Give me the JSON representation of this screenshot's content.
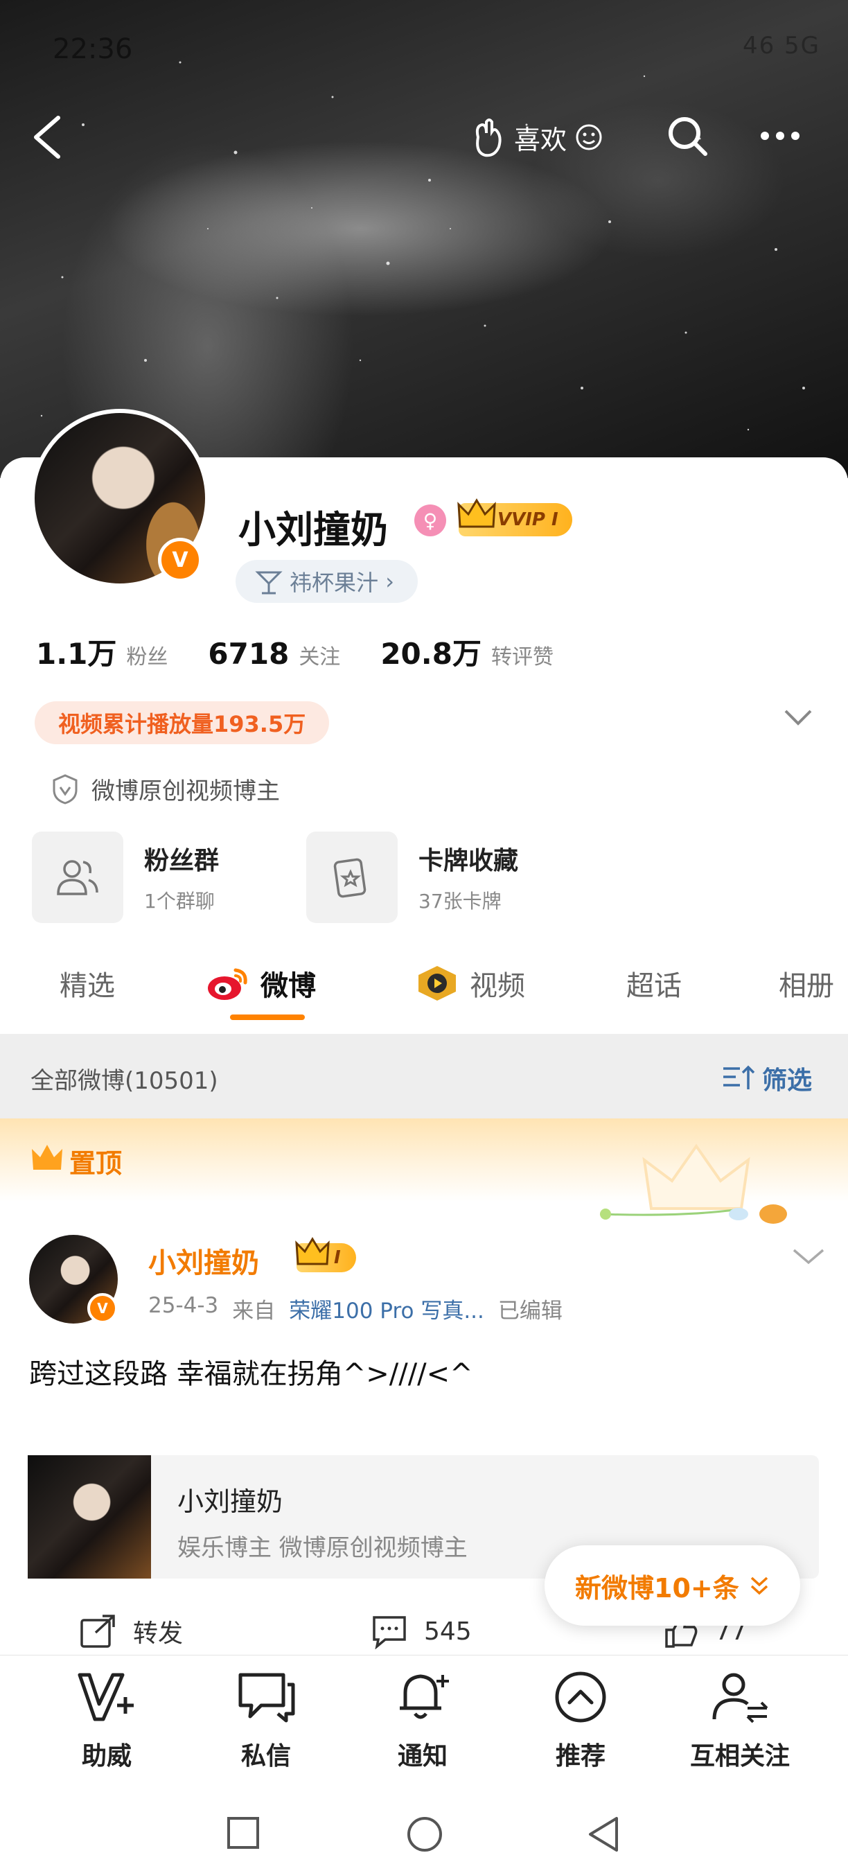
{
  "status_bar": {
    "time": "22:36",
    "right": "46 5G"
  },
  "header": {
    "like_label": "喜欢"
  },
  "profile": {
    "name": "小刘撞奶",
    "vip_label": "VVIP I",
    "tag": "祎杯果汁",
    "tag_chevron": "›",
    "stats": [
      {
        "value": "1.1万",
        "label": "粉丝"
      },
      {
        "value": "6718",
        "label": "关注"
      },
      {
        "value": "20.8万",
        "label": "转评赞"
      }
    ],
    "video_plays": "视频累计播放量193.5万",
    "original_badge": "微博原创视频博主",
    "tiles": [
      {
        "title": "粉丝群",
        "sub": "1个群聊"
      },
      {
        "title": "卡牌收藏",
        "sub": "37张卡牌"
      }
    ]
  },
  "tabs": [
    {
      "label": "精选"
    },
    {
      "label": "微博"
    },
    {
      "label": "视频"
    },
    {
      "label": "超话"
    },
    {
      "label": "相册"
    }
  ],
  "filter": {
    "count_label": "全部微博(10501)",
    "filter_label": "筛选"
  },
  "pinned": {
    "label": "置顶"
  },
  "post": {
    "author": "小刘撞奶",
    "vip_label": "I",
    "date": "25-4-3",
    "from": "来自",
    "source": "荣耀100 Pro 写真...",
    "edited": "已编辑",
    "text": "跨过这段路 幸福就在拐角^>////<^",
    "link_title": "小刘撞奶",
    "link_desc": "娱乐博主 微博原创视频博主",
    "actions": {
      "repost": "转发",
      "comments": "545",
      "likes": "77"
    }
  },
  "new_posts": {
    "label": "新微博10+条"
  },
  "bottom_nav": [
    {
      "label": "助威"
    },
    {
      "label": "私信"
    },
    {
      "label": "通知"
    },
    {
      "label": "推荐"
    },
    {
      "label": "互相关注"
    }
  ],
  "colors": {
    "accent": "#ff8200",
    "link": "#3c6fa8",
    "tab_underline": "#ff8200"
  }
}
